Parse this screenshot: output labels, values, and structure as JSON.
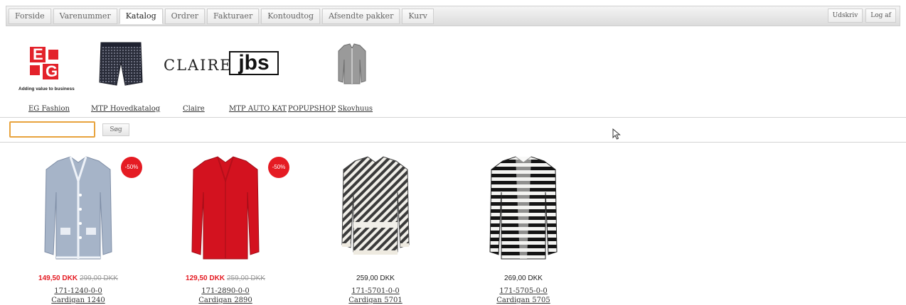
{
  "nav": {
    "tabs": [
      {
        "label": "Forside"
      },
      {
        "label": "Varenummer"
      },
      {
        "label": "Katalog"
      },
      {
        "label": "Ordrer"
      },
      {
        "label": "Fakturaer"
      },
      {
        "label": "Kontoudtog"
      },
      {
        "label": "Afsendte pakker"
      },
      {
        "label": "Kurv"
      }
    ],
    "active_tab": "Katalog",
    "print_label": "Udskriv",
    "logout_label": "Log af"
  },
  "brands": {
    "eg_logo_letters": "EG",
    "eg_tagline": "Adding value to business",
    "claire_logo": "CLAIRE",
    "jbs_logo": "jbs",
    "links": [
      {
        "label": "EG Fashion"
      },
      {
        "label": "MTP Hovedkatalog"
      },
      {
        "label": "Claire"
      },
      {
        "label": "MTP AUTO KAT"
      },
      {
        "label": "POPUPSHOP"
      },
      {
        "label": "Skovhuus"
      }
    ]
  },
  "search": {
    "value": "",
    "placeholder": "",
    "button_label": "Søg"
  },
  "colors": {
    "accent_red": "#e51b23",
    "eg_red": "#e3222b",
    "focus_orange": "#e8a33d"
  },
  "products": [
    {
      "badge": "-50%",
      "price": "149,50 DKK",
      "old_price": "299,00 DKK",
      "sku": "171-1240-0-0",
      "name": "Cardigan 1240",
      "image": "light-blue-cardigan"
    },
    {
      "badge": "-50%",
      "price": "129,50 DKK",
      "old_price": "259,00 DKK",
      "sku": "171-2890-0-0",
      "name": "Cardigan 2890",
      "image": "red-cardigan"
    },
    {
      "badge": "",
      "price": "259,00 DKK",
      "old_price": "",
      "sku": "171-5701-0-0",
      "name": "Cardigan 5701",
      "image": "black-white-tweed-jacket"
    },
    {
      "badge": "",
      "price": "269,00 DKK",
      "old_price": "",
      "sku": "171-5705-0-0",
      "name": "Cardigan 5705",
      "image": "striped-cardigan"
    }
  ]
}
